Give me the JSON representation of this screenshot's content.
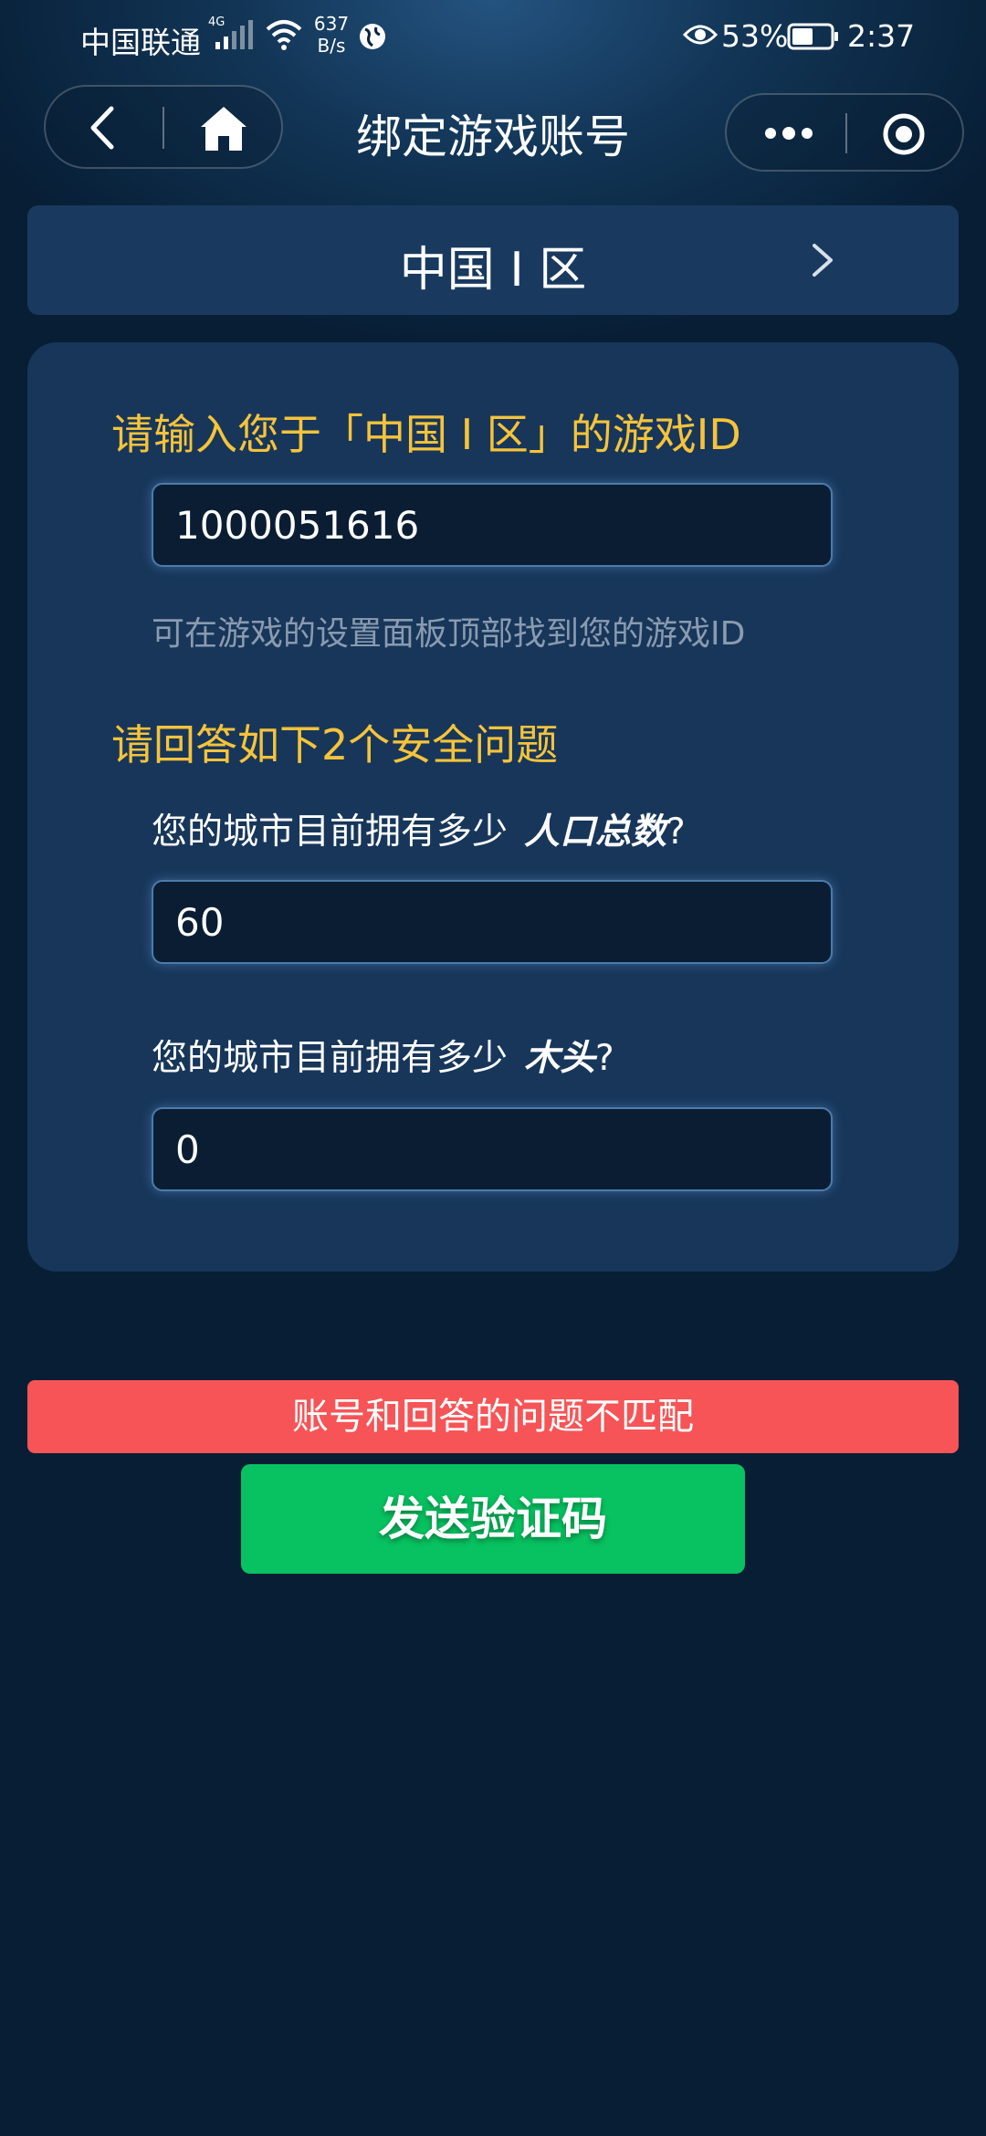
{
  "status_bar": {
    "carrier": "中国联通",
    "network_type": "4G",
    "speed_value": "637",
    "speed_unit": "B/s",
    "battery": "53%",
    "time": "2:37"
  },
  "nav": {
    "title": "绑定游戏账号",
    "icons": [
      "back-icon",
      "home-icon",
      "more-icon",
      "target-icon"
    ]
  },
  "region": {
    "label": "中国 I 区"
  },
  "form": {
    "game_id_heading": "请输入您于「中国 I 区」的游戏ID",
    "game_id_value": "1000051616",
    "game_id_hint": "可在游戏的设置面板顶部找到您的游戏ID",
    "security_heading": "请回答如下2个安全问题",
    "questions": [
      {
        "prefix": "您的城市目前拥有多少",
        "keyword": "人口总数",
        "suffix": "?",
        "value": "60"
      },
      {
        "prefix": "您的城市目前拥有多少",
        "keyword": "木头",
        "suffix": "?",
        "value": "0"
      }
    ]
  },
  "error_message": "账号和回答的问题不匹配",
  "send_button_label": "发送验证码",
  "colors": {
    "background": "#071e35",
    "card": "#17365a",
    "heading": "#f6c33a",
    "error": "#f65456",
    "button": "#08c160"
  }
}
